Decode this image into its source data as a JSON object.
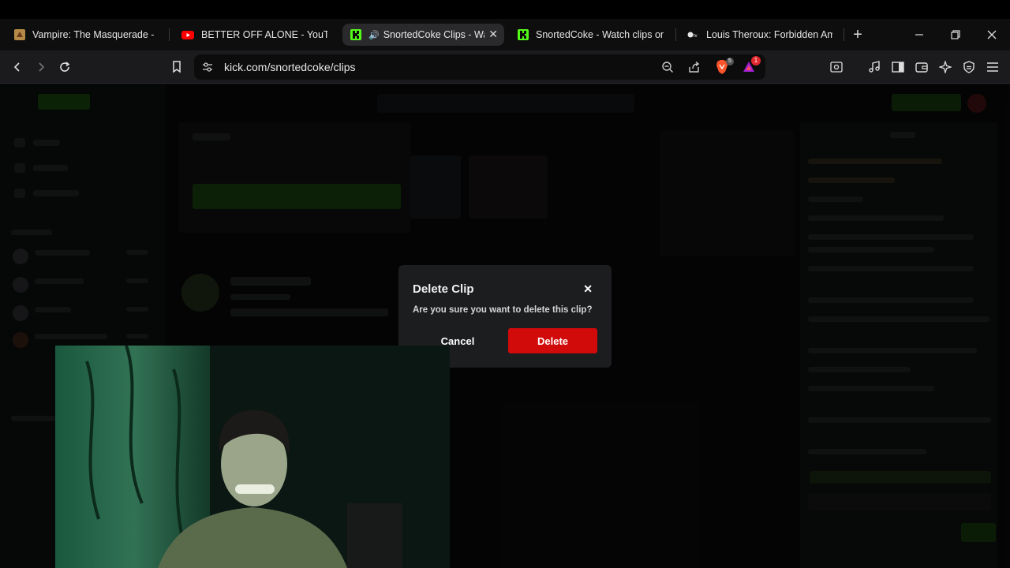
{
  "browser": {
    "tabs": [
      {
        "title": "Vampire: The Masquerade - Blo",
        "icon": "vampire-game-icon",
        "active": false
      },
      {
        "title": "BETTER OFF ALONE - YouTube",
        "icon": "youtube-icon",
        "active": false
      },
      {
        "title": "SnortedCoke Clips - Wa",
        "icon": "kick-icon",
        "active": true,
        "audio": true
      },
      {
        "title": "SnortedCoke - Watch clips on K",
        "icon": "kick-icon",
        "active": false
      },
      {
        "title": "Louis Theroux: Forbidden Ame",
        "icon": "appletv-icon",
        "active": false
      }
    ],
    "address": "kick.com/snortedcoke/clips",
    "badges": {
      "brave_count": "5",
      "rewards_count": "1"
    }
  },
  "modal": {
    "title": "Delete Clip",
    "message": "Are you sure you want to delete this clip?",
    "cancel_label": "Cancel",
    "delete_label": "Delete"
  },
  "colors": {
    "kick_green": "#53fc18",
    "delete_red": "#d10a0a"
  }
}
